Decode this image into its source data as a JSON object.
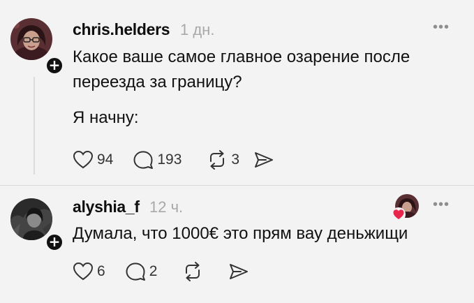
{
  "posts": [
    {
      "username": "chris.helders",
      "time": "1 дн.",
      "text_lines": [
        "Какое ваше самое главное озарение после",
        "переезда за границу?",
        "Я начну:"
      ],
      "likes": "94",
      "replies": "193",
      "reposts": "3"
    },
    {
      "username": "alyshia_f",
      "time": "12 ч.",
      "text_lines": [
        "Думала, что 1000€ это прям вау деньжищи"
      ],
      "likes": "6",
      "replies": "2",
      "reposts": ""
    }
  ],
  "more_label": "•••",
  "follow_label": "+",
  "icons": {
    "like": "heart-outline-icon",
    "reply": "speech-bubble-icon",
    "repost": "repost-arrows-icon",
    "share": "send-icon",
    "liked_by": "red-heart-icon"
  },
  "colors": {
    "background": "#f3f3f3",
    "text": "#111111",
    "muted": "#a8a8a8",
    "liked_heart": "#e8254b"
  }
}
